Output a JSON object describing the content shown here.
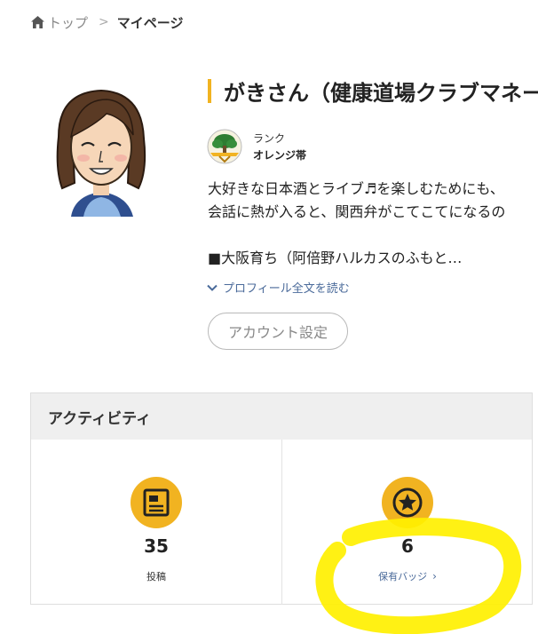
{
  "breadcrumb": {
    "home_label": "トップ",
    "separator": ">",
    "current_label": "マイページ"
  },
  "profile": {
    "title": "がきさん（健康道場クラブマネー",
    "rank_label": "ランク",
    "rank_value": "オレンジ帯",
    "bio_lines": [
      "大好きな日本酒とライブ♬を楽しむためにも、",
      "会話に熱が入ると、関西弁がこてこてになるの",
      "■大阪育ち（阿倍野ハルカスのふもと…"
    ],
    "read_more": "プロフィール全文を読む",
    "account_button": "アカウント設定"
  },
  "activity": {
    "title": "アクティビティ",
    "posts_count": "35",
    "posts_label": "投稿",
    "badges_count": "6",
    "badges_label": "保有バッジ"
  },
  "colors": {
    "accent": "#f1b321",
    "link": "#4a6a9a",
    "highlight": "#fff000"
  },
  "icons": {
    "home": "home-icon",
    "rank": "bonsai-tree-badge-icon",
    "posts": "article-icon",
    "badges": "star-badge-icon"
  }
}
